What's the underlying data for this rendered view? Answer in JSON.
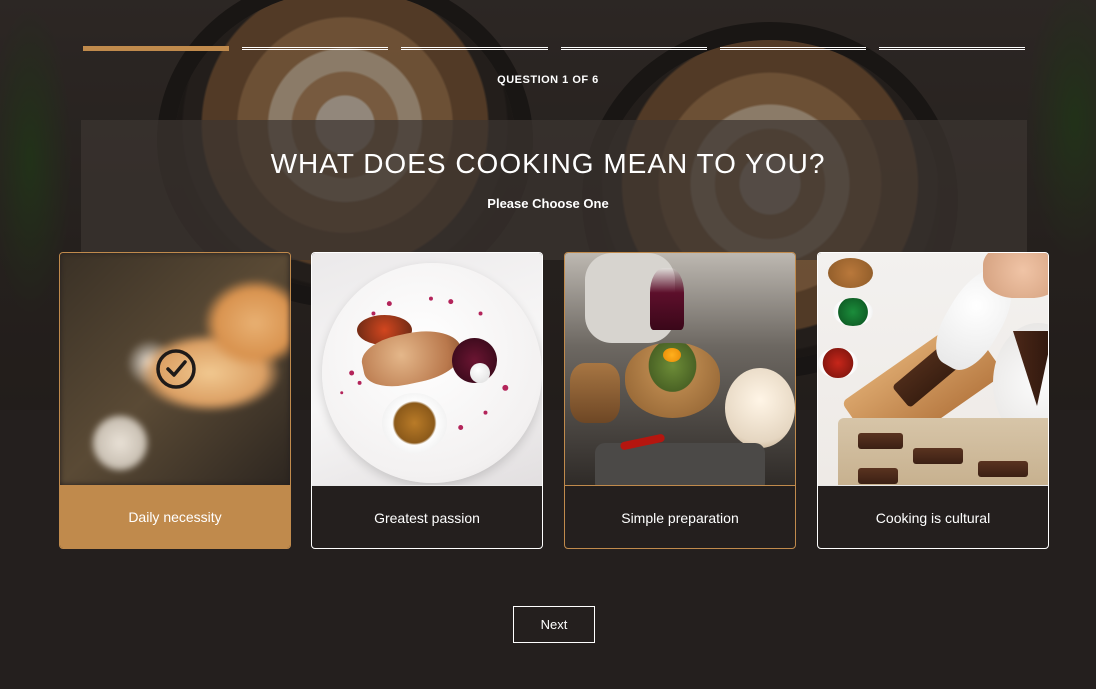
{
  "progress": {
    "total_steps": 6,
    "current_step": 1,
    "label": "QUESTION 1 OF 6"
  },
  "question": {
    "title": "WHAT DOES COOKING MEAN TO YOU?",
    "subtitle": "Please Choose One"
  },
  "options": [
    {
      "label": "Daily necessity",
      "image": "grilled-sandwich",
      "state": "selected"
    },
    {
      "label": "Greatest passion",
      "image": "plated-fish-dish",
      "state": "default"
    },
    {
      "label": "Simple preparation",
      "image": "rustic-table-spread",
      "state": "hover"
    },
    {
      "label": "Cooking is cultural",
      "image": "decorating-brownies",
      "state": "default"
    }
  ],
  "actions": {
    "next_label": "Next"
  },
  "colors": {
    "accent": "#c08a4c",
    "background": "#241f1e",
    "text": "#ffffff"
  },
  "icons": {
    "selected": "check-circle-icon"
  }
}
